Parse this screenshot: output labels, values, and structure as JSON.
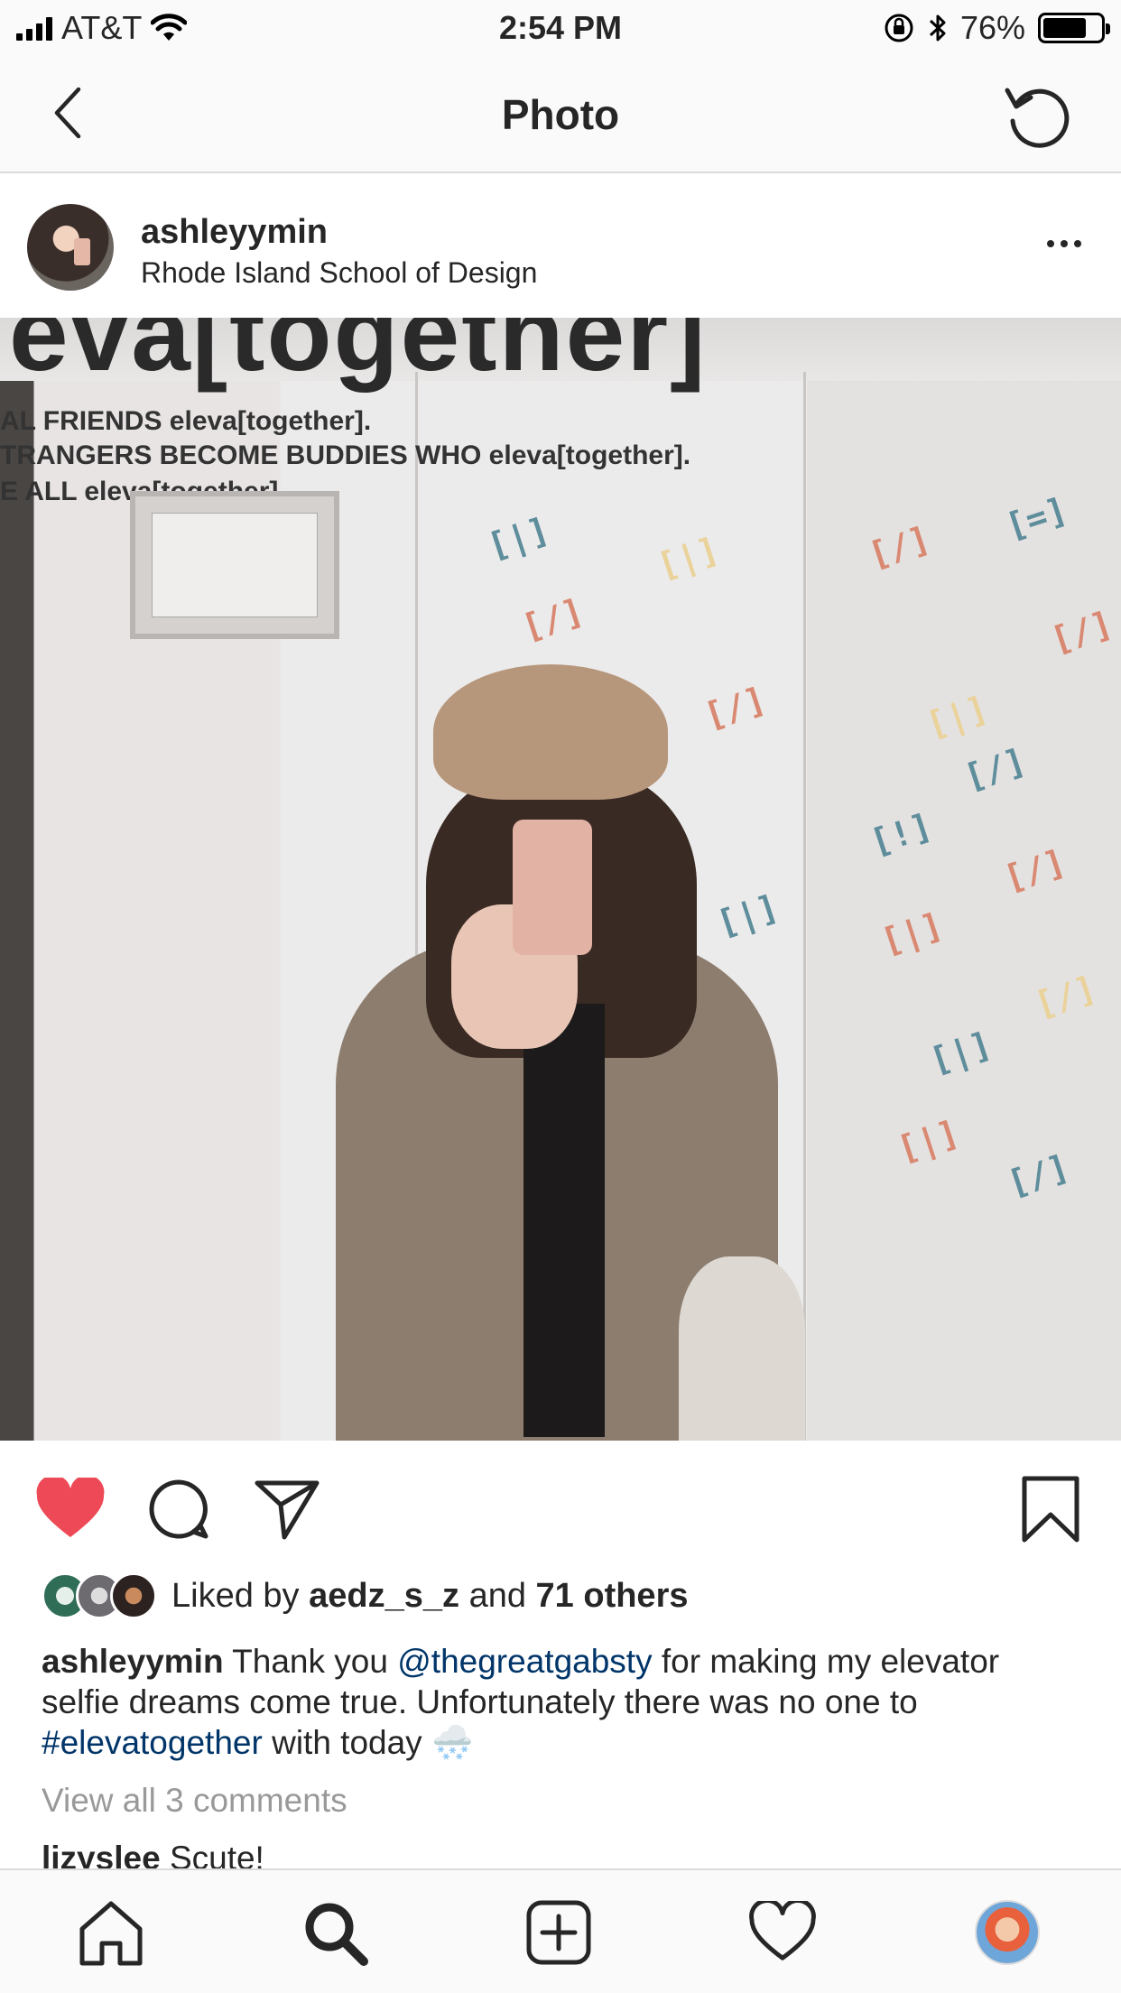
{
  "status_bar": {
    "carrier": "AT&T",
    "time": "2:54 PM",
    "battery": "76%",
    "battery_level": 0.76
  },
  "nav": {
    "title": "Photo",
    "back_icon": "chevron-left-icon",
    "refresh_icon": "refresh-icon"
  },
  "post": {
    "username": "ashleyymin",
    "location": "Rhode Island School of Design"
  },
  "photo": {
    "headline": "eva[together]",
    "lines": [
      "AL FRIENDS eleva[together].",
      "TRANGERS BECOME BUDDIES WHO eleva[together].",
      "E ALL eleva[together]."
    ]
  },
  "likes": {
    "prefix": "Liked by",
    "user": "aedz_s_z",
    "middle": "and",
    "others": "71 others"
  },
  "caption": {
    "username": "ashleyymin",
    "text_1": " Thank you ",
    "mention": "@thegreatgabsty",
    "text_2": " for making my elevator selfie dreams come true. Unfortunately there was no one to ",
    "hashtag": "#elevatogether",
    "text_3": " with today ",
    "emoji": "🌨️"
  },
  "comments": {
    "view_all": "View all 3 comments",
    "first_user": "lizyslee",
    "first_text": "Scute!"
  },
  "colors": {
    "like_red": "#ed4956",
    "link_blue": "#003569",
    "muted_gray": "#999999",
    "border": "#dbdbdb"
  }
}
